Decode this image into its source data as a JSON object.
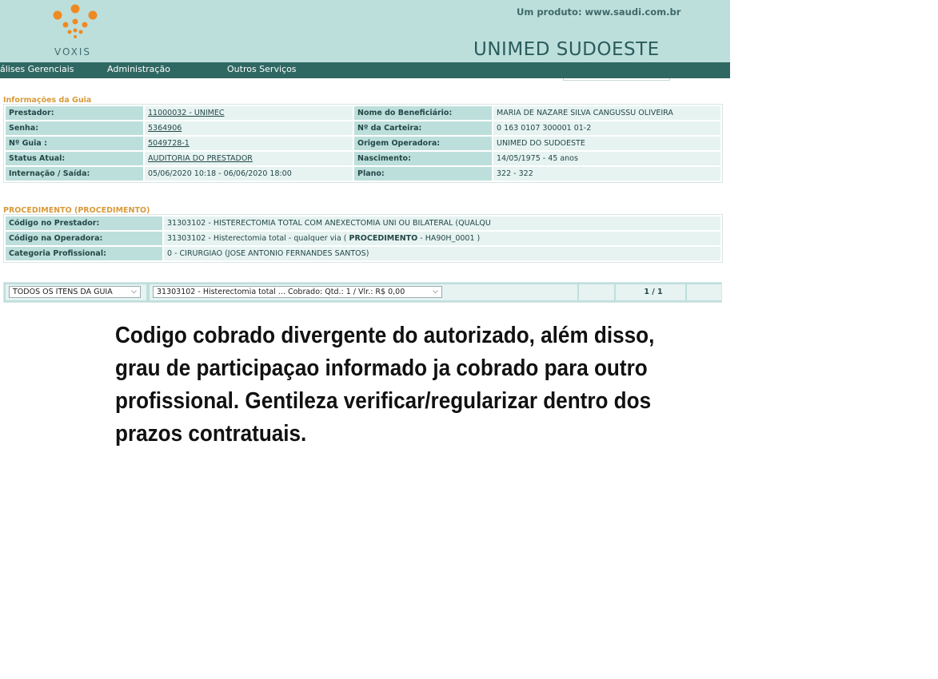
{
  "header": {
    "logo_text": "VOXIS",
    "product_text": "Um produto: www.saudi.com.br",
    "brand_text": "UNIMED SUDOESTE",
    "logo_color": "#ee8a22",
    "background": "#bddfdc"
  },
  "menu": {
    "items": [
      "álises Gerenciais",
      "Administração",
      "Outros Serviços"
    ]
  },
  "guia": {
    "section_title": "Informações da Guia",
    "rows": [
      {
        "label1": "Prestador:",
        "value1": "11000032 - UNIMEC",
        "label2": "Nome do Beneficiário:",
        "value2": "MARIA DE NAZARE SILVA CANGUSSU OLIVEIRA"
      },
      {
        "label1": "Senha:",
        "value1": "5364906",
        "label2": "Nº da Carteira:",
        "value2": "0 163 0107 300001 01-2"
      },
      {
        "label1": "Nº Guia :",
        "value1": "5049728-1",
        "label2": "Origem Operadora:",
        "value2": "UNIMED DO SUDOESTE"
      },
      {
        "label1": "Status Atual:",
        "value1": "AUDITORIA DO PRESTADOR",
        "label2": "Nascimento:",
        "value2": "14/05/1975 - 45 anos"
      },
      {
        "label1": "Internação / Saída:",
        "value1": "05/06/2020 10:18 - 06/06/2020 18:00",
        "label2": "Plano:",
        "value2": "322 - 322"
      }
    ]
  },
  "procedimento": {
    "section_title": "PROCEDIMENTO (PROCEDIMENTO)",
    "codigo_prestador_label": "Código no Prestador:",
    "codigo_prestador_value": "31303102 - HISTERECTOMIA TOTAL COM ANEXECTOMIA UNI OU BILATERAL (QUALQU",
    "codigo_operadora_label": "Código na Operadora:",
    "codigo_operadora_prefix": "31303102 - Histerectomia total - qualquer via (",
    "codigo_operadora_bold": "PROCEDIMENTO",
    "codigo_operadora_suffix": "- HA90H_0001 )",
    "categoria_label": "Categoria Profissional:",
    "categoria_value": "0 - CIRURGIAO (JOSE ANTONIO FERNANDES SANTOS)"
  },
  "navigation": {
    "filter_select": "TODOS OS ITENS DA GUIA",
    "item_select": "31303102 - Histerectomia total ... Cobrado: Qtd.: 1 / Vlr.: R$ 0,00",
    "page_indicator": "1 / 1"
  },
  "note": {
    "text": "Codigo cobrado divergente do autorizado, além disso, grau de participaçao informado ja cobrado para outro profissional. Gentileza verificar/regularizar dentro dos prazos contratuais."
  }
}
